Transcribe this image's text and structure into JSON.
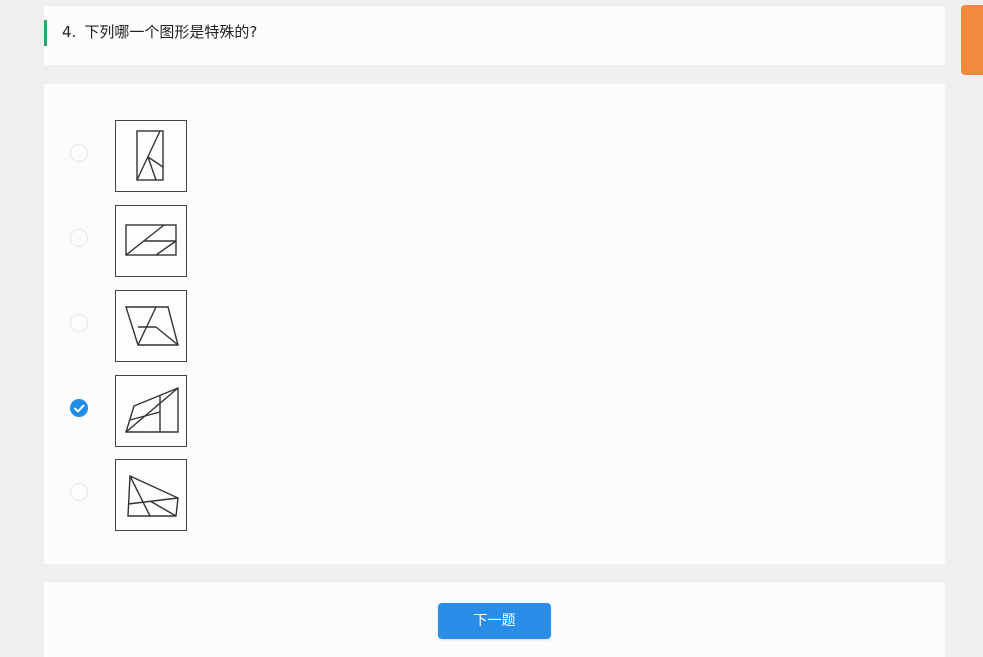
{
  "question": {
    "number": "4.",
    "text": "下列哪一个图形是特殊的?"
  },
  "options": [
    {
      "figure_icon": "rectangle-with-diagonals-figure-icon",
      "selected": false
    },
    {
      "figure_icon": "wide-rectangle-with-diagonals-figure-icon",
      "selected": false
    },
    {
      "figure_icon": "trapezoid-with-diagonals-figure-icon",
      "selected": false
    },
    {
      "figure_icon": "parallelogram-with-lines-figure-icon",
      "selected": true
    },
    {
      "figure_icon": "quadrilateral-with-diagonals-figure-icon",
      "selected": false
    }
  ],
  "footer": {
    "next_label": "下一题"
  },
  "colors": {
    "accent": "#2a8ee8",
    "question_marker": "#2aa96b",
    "side_tab": "#f18a3d"
  }
}
